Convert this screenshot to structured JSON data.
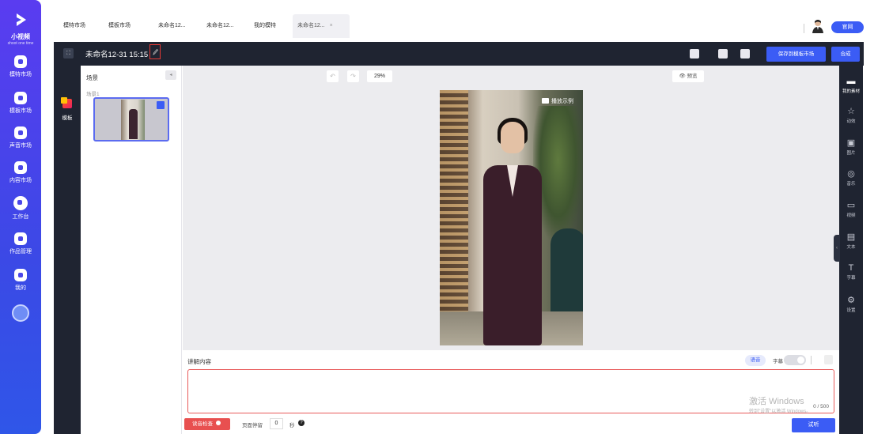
{
  "brand": {
    "name": "小视频",
    "tagline": "shoot one time"
  },
  "sidebar": {
    "items": [
      {
        "label": "模特市场"
      },
      {
        "label": "模板市场"
      },
      {
        "label": "声音市场"
      },
      {
        "label": "内容市场"
      },
      {
        "label": "工作台"
      },
      {
        "label": "作品管理"
      },
      {
        "label": "我的"
      }
    ]
  },
  "tabs": [
    {
      "label": "模特市场"
    },
    {
      "label": "模板市场"
    },
    {
      "label": "未命名12..."
    },
    {
      "label": "未命名12..."
    },
    {
      "label": "我的模特"
    },
    {
      "label": "未命名12...",
      "close": "×"
    }
  ],
  "topbar": {
    "official_label": "官网"
  },
  "editor": {
    "title": "未命名12-31 15:15",
    "save_label": "保存到模板市场",
    "compose_label": "合成"
  },
  "toolcolumn": {
    "template_label": "模板"
  },
  "scenes": {
    "title": "场景",
    "scene_label": "场景1"
  },
  "canvas": {
    "zoom": "29%",
    "preview_label": "预览",
    "badge_label": "播放示例"
  },
  "rightbar": {
    "items": [
      {
        "label": "我的素材",
        "icon": "folder-icon"
      },
      {
        "label": "动效",
        "icon": "star-icon"
      },
      {
        "label": "图片",
        "icon": "image-icon"
      },
      {
        "label": "音乐",
        "icon": "music-icon"
      },
      {
        "label": "视频",
        "icon": "video-icon"
      },
      {
        "label": "文本",
        "icon": "text-icon"
      },
      {
        "label": "字幕",
        "icon": "subtitle-icon"
      },
      {
        "label": "设置",
        "icon": "settings-icon"
      }
    ]
  },
  "narration": {
    "title": "讲解内容",
    "voice_label": "语音",
    "subtitle_label": "字幕",
    "counter": "0 / 500",
    "check_label": "读音检查",
    "pause_label": "页面停留",
    "pause_value": "0",
    "sec_label": "秒",
    "try_label": "试听"
  },
  "watermark": {
    "line1": "激活 Windows",
    "line2": "转到\"设置\"以激活 Windows。"
  },
  "colors": {
    "accent": "#3b5cf5",
    "sidebar": "#4b46e8",
    "dark": "#1f2431",
    "danger": "#e85050"
  }
}
